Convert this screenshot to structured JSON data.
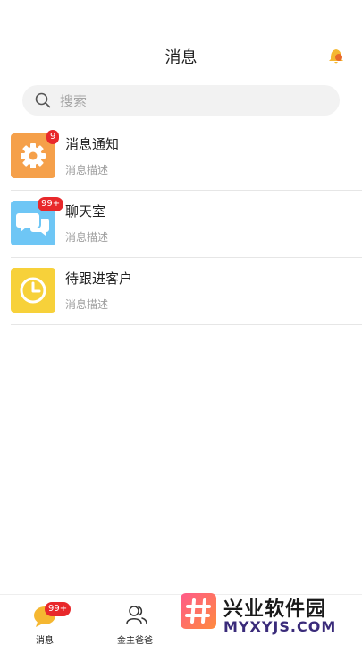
{
  "header": {
    "title": "消息"
  },
  "search": {
    "placeholder": "搜索"
  },
  "items": [
    {
      "name": "消息通知",
      "desc": "消息描述",
      "badge": "9",
      "icon": "gear-icon",
      "color": "#f5a04a"
    },
    {
      "name": "聊天室",
      "desc": "消息描述",
      "badge": "99+",
      "icon": "chat-bubbles-icon",
      "color": "#6ec6f5"
    },
    {
      "name": "待跟进客户",
      "desc": "消息描述",
      "badge": "",
      "icon": "clock-icon",
      "color": "#f7d13a"
    }
  ],
  "tabbar": {
    "tabs": [
      {
        "label": "消息",
        "badge": "99+",
        "icon": "message-bubble-icon"
      },
      {
        "label": "金主爸爸",
        "icon": "users-icon"
      }
    ]
  },
  "watermark": {
    "title": "兴业软件园",
    "subtitle": "MYXYJS.COM"
  },
  "colors": {
    "badge": "#e8282b",
    "accent": "#f5b731"
  }
}
